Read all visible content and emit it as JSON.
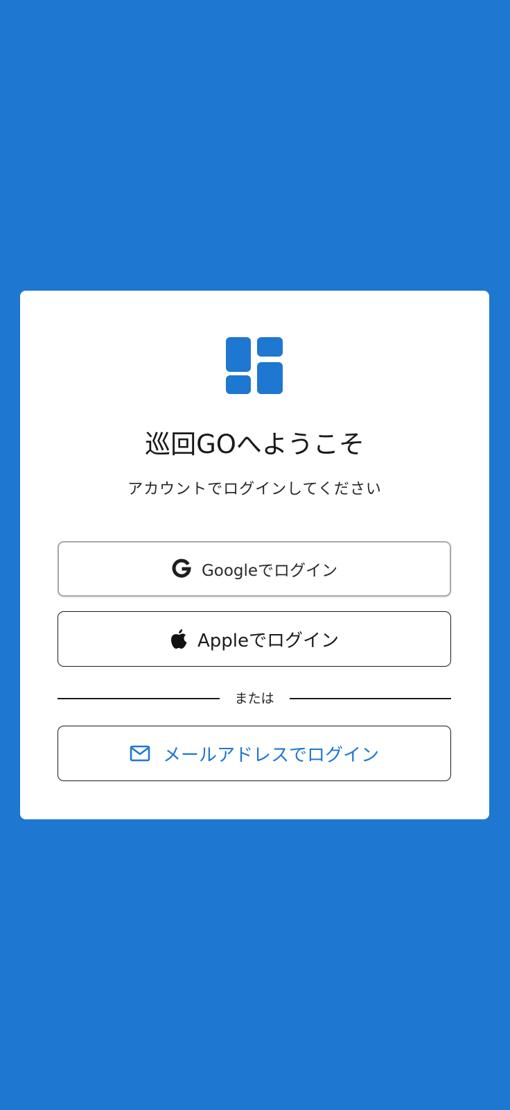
{
  "colors": {
    "background": "#1E77D0",
    "accent": "#1E77D0",
    "card": "#FFFFFF"
  },
  "app": {
    "logo_icon": "grid-logo-icon",
    "title": "巡回GOへようこそ",
    "subtitle": "アカウントでログインしてください"
  },
  "auth": {
    "google_label": "Googleでログイン",
    "google_icon": "google-icon",
    "apple_label": "Appleでログイン",
    "apple_icon": "apple-icon",
    "divider_text": "または",
    "email_label": "メールアドレスでログイン",
    "email_icon": "mail-icon"
  }
}
